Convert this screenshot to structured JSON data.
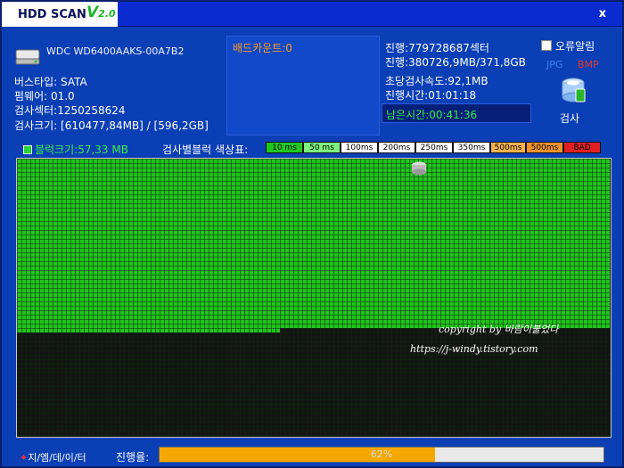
{
  "title": {
    "name": "HDD SCAN",
    "version_v": "V",
    "version_num": "2.0",
    "close": "x"
  },
  "disk": {
    "model": "WDC WD6400AAKS-00A7B2",
    "bus": "버스타입: SATA",
    "firmware": "펌웨어: 01.0",
    "sectors": "검사섹터:1250258624",
    "size": "검사크기: [610477,84MB] / [596,2GB]"
  },
  "bad": {
    "count": "배드카운트:0"
  },
  "progress": {
    "sector": "진행:779728687섹터",
    "amount": "진행:380726,9MB/371,8GB",
    "speed": "초당검사속도:92,1MB",
    "elapsed": "진행시간:01:01:18",
    "remaining": "남은시간:00:41:36"
  },
  "options": {
    "error_alarm": "오류알림",
    "jpg": "JPG",
    "bmp": "BMP",
    "scan": "검사"
  },
  "legend": {
    "block_size": "블럭크기:57,33 MB",
    "title": "검사별블럭 색상표:",
    "items": [
      {
        "label": "10 ms",
        "color": "#1fc81f"
      },
      {
        "label": "50 ms",
        "color": "#7df07d"
      },
      {
        "label": "100ms",
        "color": "#ffffff"
      },
      {
        "label": "200ms",
        "color": "#ffffff"
      },
      {
        "label": "250ms",
        "color": "#ffffff"
      },
      {
        "label": "350ms",
        "color": "#ffffff"
      },
      {
        "label": "500ms",
        "color": "#f5b24a"
      },
      {
        "label": "500ms",
        "color": "#f0922a"
      },
      {
        "label": "BAD",
        "color": "#e02020"
      }
    ]
  },
  "grid": {
    "progress_fraction": 0.62,
    "ok_color": "#22c21e",
    "empty_color": "#141414"
  },
  "watermark": {
    "line1": "copyright by 바람이불었다",
    "line2": "https://j-windy.tistory.com"
  },
  "status": {
    "brand_star": "✦",
    "brand": "지/엠/데/이/터",
    "progress_label": "진행율:",
    "percent": "62%",
    "progress_value": 0.62
  },
  "colors": {
    "accent": "#0b3fb5",
    "title": "#0a2bd0",
    "progress": "#f5a800"
  }
}
